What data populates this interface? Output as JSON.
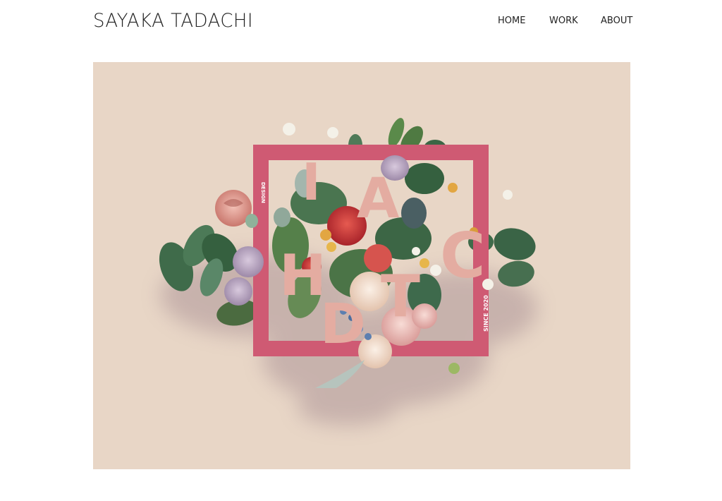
{
  "site": {
    "title": "SAYAKA TADACHI"
  },
  "nav": {
    "items": [
      {
        "label": "HOME"
      },
      {
        "label": "WORK"
      },
      {
        "label": "ABOUT"
      }
    ]
  },
  "artwork": {
    "letters": [
      "I",
      "A",
      "H",
      "C",
      "T",
      "D"
    ],
    "side_text_left": "DESIGN",
    "side_text_right": "SINCE 2020",
    "colors": {
      "background": "#e8d6c6",
      "frame": "#cf5a73",
      "letters": "#e4aca1",
      "leaf": "#3d6a45"
    }
  }
}
